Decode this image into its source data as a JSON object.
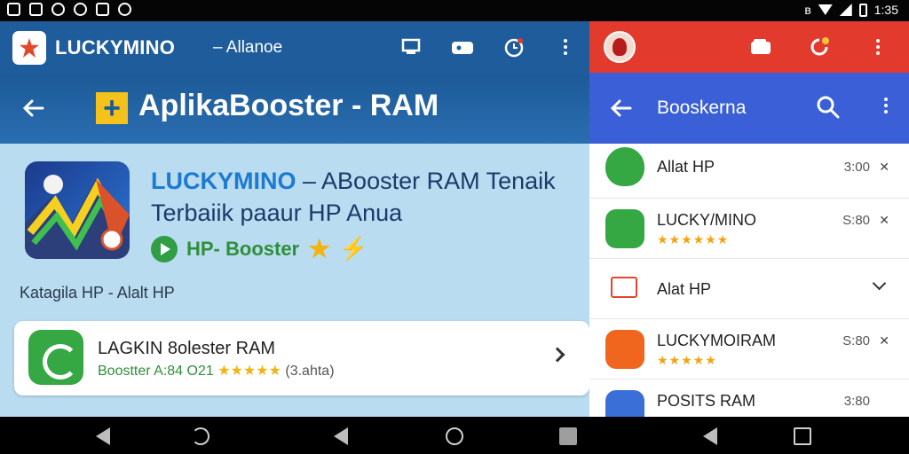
{
  "status_bar": {
    "time": "1:35"
  },
  "left_app": {
    "appbar": {
      "name": "LUCKYMINO",
      "sub": "– Allanoe"
    },
    "title": "AplikaBooster - RAM",
    "plus_glyph": "+",
    "hero": {
      "brand": "LUCKYMINO",
      "title_rest": " – ABooster RAM Tenaik Terbaiik paaur HP Anua",
      "tag": "HP- Booster",
      "star": "★",
      "bolt": "⚡"
    },
    "category": "Katagila HP - Alalt HP",
    "card": {
      "title": "LAGKIN 8olester RAM",
      "sub_prefix": "Boostter A:84 O21",
      "stars": "★★★★★",
      "count": "(3.ahta)"
    }
  },
  "right_app": {
    "title": "Booskerna",
    "items": [
      {
        "name": "Allat HP",
        "time": "3:00",
        "x": "✕",
        "icon_color": "#35a844"
      },
      {
        "name": "LUCKY/MINO",
        "stars": "★★★★★★",
        "time": "S:80",
        "x": "✕",
        "icon_color": "#35a844"
      },
      {
        "name": "Alat HP",
        "icon_color": "#ffffff"
      },
      {
        "name": "LUCKYMOIRAM",
        "stars": "★★★★★",
        "time": "S:80",
        "x": "✕",
        "icon_color": "#f0661f"
      },
      {
        "name": "POSITS RAM",
        "time": "3:80",
        "icon_color": "#3a6fd8"
      }
    ]
  },
  "colors": {
    "left_appbar": "#1e5c9c",
    "left_bg": "#b9dcf0",
    "right_top": "#e33a2e",
    "right_bar": "#3a5fd6",
    "brand_blue": "#1d7ad1",
    "green": "#2f8f3a",
    "star": "#f3b40f"
  }
}
